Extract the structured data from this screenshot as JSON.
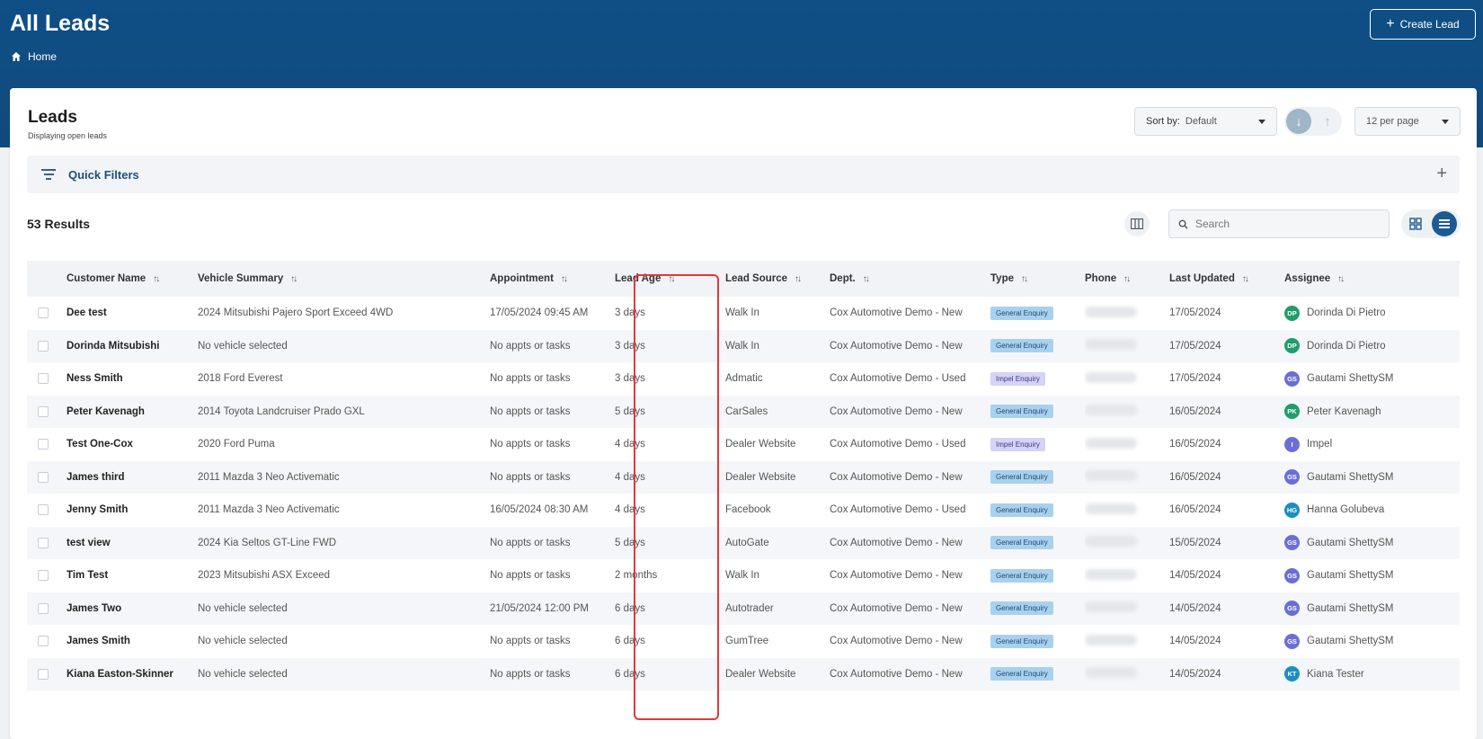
{
  "header": {
    "title": "All Leads",
    "breadcrumb_home": "Home",
    "create_button": "Create Lead"
  },
  "card": {
    "title": "Leads",
    "subtitle": "Displaying open leads",
    "sort_label": "Sort by:",
    "sort_value": "Default",
    "per_page": "12 per page"
  },
  "quick_filters": {
    "label": "Quick Filters"
  },
  "results": {
    "count_text": "53 Results"
  },
  "search": {
    "placeholder": "Search"
  },
  "table": {
    "columns": [
      "Customer Name",
      "Vehicle Summary",
      "Appointment",
      "Lead Age",
      "Lead Source",
      "Dept.",
      "Type",
      "Phone",
      "Last Updated",
      "Assignee"
    ],
    "rows": [
      {
        "name": "Dee test",
        "vehicle": "2024 Mitsubishi Pajero Sport Exceed 4WD",
        "appointment": "17/05/2024 09:45 AM",
        "age": "3 days",
        "source": "Walk In",
        "dept": "Cox Automotive Demo - New",
        "type": "General Enquiry",
        "type_kind": "general",
        "updated": "17/05/2024",
        "initials": "DP",
        "avatar_color": "#1f9d6b",
        "assignee": "Dorinda Di Pietro"
      },
      {
        "name": "Dorinda Mitsubishi",
        "vehicle": "No vehicle selected",
        "appointment": "No appts or tasks",
        "age": "3 days",
        "source": "Walk In",
        "dept": "Cox Automotive Demo - New",
        "type": "General Enquiry",
        "type_kind": "general",
        "updated": "17/05/2024",
        "initials": "DP",
        "avatar_color": "#1f9d6b",
        "assignee": "Dorinda Di Pietro"
      },
      {
        "name": "Ness Smith",
        "vehicle": "2018 Ford Everest",
        "appointment": "No appts or tasks",
        "age": "3 days",
        "source": "Admatic",
        "dept": "Cox Automotive Demo - Used",
        "type": "Impel Enquiry",
        "type_kind": "impel",
        "updated": "17/05/2024",
        "initials": "GS",
        "avatar_color": "#6a6fd6",
        "assignee": "Gautami ShettySM"
      },
      {
        "name": "Peter Kavenagh",
        "vehicle": "2014 Toyota Landcruiser Prado GXL",
        "appointment": "No appts or tasks",
        "age": "5 days",
        "source": "CarSales",
        "dept": "Cox Automotive Demo - New",
        "type": "General Enquiry",
        "type_kind": "general",
        "updated": "16/05/2024",
        "initials": "PK",
        "avatar_color": "#1f9d6b",
        "assignee": "Peter Kavenagh"
      },
      {
        "name": "Test One-Cox",
        "vehicle": "2020 Ford Puma",
        "appointment": "No appts or tasks",
        "age": "4 days",
        "source": "Dealer Website",
        "dept": "Cox Automotive Demo - Used",
        "type": "Impel Enquiry",
        "type_kind": "impel",
        "updated": "16/05/2024",
        "initials": "I",
        "avatar_color": "#6a6fd6",
        "assignee": "Impel"
      },
      {
        "name": "James third",
        "vehicle": "2011 Mazda 3 Neo Activematic",
        "appointment": "No appts or tasks",
        "age": "4 days",
        "source": "Dealer Website",
        "dept": "Cox Automotive Demo - New",
        "type": "General Enquiry",
        "type_kind": "general",
        "updated": "16/05/2024",
        "initials": "GS",
        "avatar_color": "#6a6fd6",
        "assignee": "Gautami ShettySM"
      },
      {
        "name": "Jenny Smith",
        "vehicle": "2011 Mazda 3 Neo Activematic",
        "appointment": "16/05/2024 08:30 AM",
        "age": "4 days",
        "source": "Facebook",
        "dept": "Cox Automotive Demo - Used",
        "type": "General Enquiry",
        "type_kind": "general",
        "updated": "16/05/2024",
        "initials": "HG",
        "avatar_color": "#1a8fbf",
        "assignee": "Hanna Golubeva"
      },
      {
        "name": "test view",
        "vehicle": "2024 Kia Seltos GT-Line FWD",
        "appointment": "No appts or tasks",
        "age": "5 days",
        "source": "AutoGate",
        "dept": "Cox Automotive Demo - New",
        "type": "General Enquiry",
        "type_kind": "general",
        "updated": "15/05/2024",
        "initials": "GS",
        "avatar_color": "#6a6fd6",
        "assignee": "Gautami ShettySM"
      },
      {
        "name": "Tim Test",
        "vehicle": "2023 Mitsubishi ASX Exceed",
        "appointment": "No appts or tasks",
        "age": "2 months",
        "source": "Walk In",
        "dept": "Cox Automotive Demo - New",
        "type": "General Enquiry",
        "type_kind": "general",
        "updated": "14/05/2024",
        "initials": "GS",
        "avatar_color": "#6a6fd6",
        "assignee": "Gautami ShettySM"
      },
      {
        "name": "James Two",
        "vehicle": "No vehicle selected",
        "appointment": "21/05/2024 12:00 PM",
        "age": "6 days",
        "source": "Autotrader",
        "dept": "Cox Automotive Demo - New",
        "type": "General Enquiry",
        "type_kind": "general",
        "updated": "14/05/2024",
        "initials": "GS",
        "avatar_color": "#6a6fd6",
        "assignee": "Gautami ShettySM"
      },
      {
        "name": "James Smith",
        "vehicle": "No vehicle selected",
        "appointment": "No appts or tasks",
        "age": "6 days",
        "source": "GumTree",
        "dept": "Cox Automotive Demo - New",
        "type": "General Enquiry",
        "type_kind": "general",
        "updated": "14/05/2024",
        "initials": "GS",
        "avatar_color": "#6a6fd6",
        "assignee": "Gautami ShettySM"
      },
      {
        "name": "Kiana Easton-Skinner",
        "vehicle": "No vehicle selected",
        "appointment": "No appts or tasks",
        "age": "6 days",
        "source": "Dealer Website",
        "dept": "Cox Automotive Demo - New",
        "type": "General Enquiry",
        "type_kind": "general",
        "updated": "14/05/2024",
        "initials": "KT",
        "avatar_color": "#1a8fbf",
        "assignee": "Kiana Tester"
      }
    ]
  }
}
